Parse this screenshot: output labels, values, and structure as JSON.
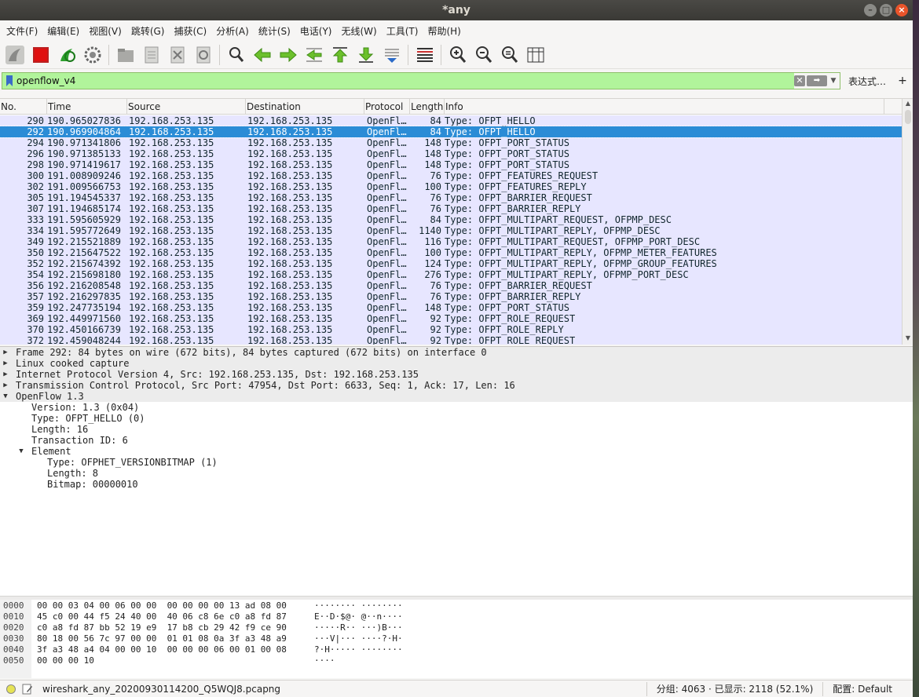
{
  "window": {
    "title": "*any"
  },
  "menu": [
    "文件(F)",
    "编辑(E)",
    "视图(V)",
    "跳转(G)",
    "捕获(C)",
    "分析(A)",
    "统计(S)",
    "电话(Y)",
    "无线(W)",
    "工具(T)",
    "帮助(H)"
  ],
  "filter": {
    "value": "openflow_v4",
    "expression_label": "表达式…",
    "plus_label": "+"
  },
  "packet_list": {
    "columns": [
      "No.",
      "Time",
      "Source",
      "Destination",
      "Protocol",
      "Length",
      "Info"
    ],
    "rows": [
      {
        "no": "290",
        "time": "190.965027836",
        "src": "192.168.253.135",
        "dst": "192.168.253.135",
        "proto": "OpenFl…",
        "len": "84",
        "info": "Type: OFPT_HELLO"
      },
      {
        "no": "292",
        "time": "190.969904864",
        "src": "192.168.253.135",
        "dst": "192.168.253.135",
        "proto": "OpenFl…",
        "len": "84",
        "info": "Type: OFPT_HELLO"
      },
      {
        "no": "294",
        "time": "190.971341806",
        "src": "192.168.253.135",
        "dst": "192.168.253.135",
        "proto": "OpenFl…",
        "len": "148",
        "info": "Type: OFPT_PORT_STATUS"
      },
      {
        "no": "296",
        "time": "190.971385133",
        "src": "192.168.253.135",
        "dst": "192.168.253.135",
        "proto": "OpenFl…",
        "len": "148",
        "info": "Type: OFPT_PORT_STATUS"
      },
      {
        "no": "298",
        "time": "190.971419617",
        "src": "192.168.253.135",
        "dst": "192.168.253.135",
        "proto": "OpenFl…",
        "len": "148",
        "info": "Type: OFPT_PORT_STATUS"
      },
      {
        "no": "300",
        "time": "191.008909246",
        "src": "192.168.253.135",
        "dst": "192.168.253.135",
        "proto": "OpenFl…",
        "len": "76",
        "info": "Type: OFPT_FEATURES_REQUEST"
      },
      {
        "no": "302",
        "time": "191.009566753",
        "src": "192.168.253.135",
        "dst": "192.168.253.135",
        "proto": "OpenFl…",
        "len": "100",
        "info": "Type: OFPT_FEATURES_REPLY"
      },
      {
        "no": "305",
        "time": "191.194545337",
        "src": "192.168.253.135",
        "dst": "192.168.253.135",
        "proto": "OpenFl…",
        "len": "76",
        "info": "Type: OFPT_BARRIER_REQUEST"
      },
      {
        "no": "307",
        "time": "191.194685174",
        "src": "192.168.253.135",
        "dst": "192.168.253.135",
        "proto": "OpenFl…",
        "len": "76",
        "info": "Type: OFPT_BARRIER_REPLY"
      },
      {
        "no": "333",
        "time": "191.595605929",
        "src": "192.168.253.135",
        "dst": "192.168.253.135",
        "proto": "OpenFl…",
        "len": "84",
        "info": "Type: OFPT_MULTIPART_REQUEST, OFPMP_DESC"
      },
      {
        "no": "334",
        "time": "191.595772649",
        "src": "192.168.253.135",
        "dst": "192.168.253.135",
        "proto": "OpenFl…",
        "len": "1140",
        "info": "Type: OFPT_MULTIPART_REPLY, OFPMP_DESC"
      },
      {
        "no": "349",
        "time": "192.215521889",
        "src": "192.168.253.135",
        "dst": "192.168.253.135",
        "proto": "OpenFl…",
        "len": "116",
        "info": "Type: OFPT_MULTIPART_REQUEST, OFPMP_PORT_DESC"
      },
      {
        "no": "350",
        "time": "192.215647522",
        "src": "192.168.253.135",
        "dst": "192.168.253.135",
        "proto": "OpenFl…",
        "len": "100",
        "info": "Type: OFPT_MULTIPART_REPLY, OFPMP_METER_FEATURES"
      },
      {
        "no": "352",
        "time": "192.215674392",
        "src": "192.168.253.135",
        "dst": "192.168.253.135",
        "proto": "OpenFl…",
        "len": "124",
        "info": "Type: OFPT_MULTIPART_REPLY, OFPMP_GROUP_FEATURES"
      },
      {
        "no": "354",
        "time": "192.215698180",
        "src": "192.168.253.135",
        "dst": "192.168.253.135",
        "proto": "OpenFl…",
        "len": "276",
        "info": "Type: OFPT_MULTIPART_REPLY, OFPMP_PORT_DESC"
      },
      {
        "no": "356",
        "time": "192.216208548",
        "src": "192.168.253.135",
        "dst": "192.168.253.135",
        "proto": "OpenFl…",
        "len": "76",
        "info": "Type: OFPT_BARRIER_REQUEST"
      },
      {
        "no": "357",
        "time": "192.216297835",
        "src": "192.168.253.135",
        "dst": "192.168.253.135",
        "proto": "OpenFl…",
        "len": "76",
        "info": "Type: OFPT_BARRIER_REPLY"
      },
      {
        "no": "359",
        "time": "192.247735194",
        "src": "192.168.253.135",
        "dst": "192.168.253.135",
        "proto": "OpenFl…",
        "len": "148",
        "info": "Type: OFPT_PORT_STATUS"
      },
      {
        "no": "369",
        "time": "192.449971560",
        "src": "192.168.253.135",
        "dst": "192.168.253.135",
        "proto": "OpenFl…",
        "len": "92",
        "info": "Type: OFPT_ROLE_REQUEST"
      },
      {
        "no": "370",
        "time": "192.450166739",
        "src": "192.168.253.135",
        "dst": "192.168.253.135",
        "proto": "OpenFl…",
        "len": "92",
        "info": "Type: OFPT_ROLE_REPLY"
      },
      {
        "no": "372",
        "time": "192.459048244",
        "src": "192.168.253.135",
        "dst": "192.168.253.135",
        "proto": "OpenFl…",
        "len": "92",
        "info": "Type: OFPT_ROLE_REQUEST"
      }
    ],
    "selected_no": "292"
  },
  "details": [
    {
      "text": "Frame 292: 84 bytes on wire (672 bits), 84 bytes captured (672 bits) on interface 0",
      "indent": 0,
      "toggle": "closed",
      "top": true
    },
    {
      "text": "Linux cooked capture",
      "indent": 0,
      "toggle": "closed",
      "top": true
    },
    {
      "text": "Internet Protocol Version 4, Src: 192.168.253.135, Dst: 192.168.253.135",
      "indent": 0,
      "toggle": "closed",
      "top": true
    },
    {
      "text": "Transmission Control Protocol, Src Port: 47954, Dst Port: 6633, Seq: 1, Ack: 17, Len: 16",
      "indent": 0,
      "toggle": "closed",
      "top": true
    },
    {
      "text": "OpenFlow 1.3",
      "indent": 0,
      "toggle": "open",
      "top": true
    },
    {
      "text": "Version: 1.3 (0x04)",
      "indent": 1,
      "toggle": "none",
      "top": false
    },
    {
      "text": "Type: OFPT_HELLO (0)",
      "indent": 1,
      "toggle": "none",
      "top": false
    },
    {
      "text": "Length: 16",
      "indent": 1,
      "toggle": "none",
      "top": false
    },
    {
      "text": "Transaction ID: 6",
      "indent": 1,
      "toggle": "none",
      "top": false
    },
    {
      "text": "Element",
      "indent": 1,
      "toggle": "open",
      "top": false
    },
    {
      "text": "Type: OFPHET_VERSIONBITMAP (1)",
      "indent": 2,
      "toggle": "none",
      "top": false
    },
    {
      "text": "Length: 8",
      "indent": 2,
      "toggle": "none",
      "top": false
    },
    {
      "text": "Bitmap: 00000010",
      "indent": 2,
      "toggle": "none",
      "top": false
    }
  ],
  "bytes": [
    {
      "off": "0000",
      "hex": "00 00 03 04 00 06 00 00  00 00 00 00 13 ad 08 00",
      "ascii": "········ ········"
    },
    {
      "off": "0010",
      "hex": "45 c0 00 44 f5 24 40 00  40 06 c8 6e c0 a8 fd 87",
      "ascii": "E··D·$@· @··n····"
    },
    {
      "off": "0020",
      "hex": "c0 a8 fd 87 bb 52 19 e9  17 b8 cb 29 42 f9 ce 90",
      "ascii": "·····R·· ···)B···"
    },
    {
      "off": "0030",
      "hex": "80 18 00 56 7c 97 00 00  01 01 08 0a 3f a3 48 a9",
      "ascii": "···V|··· ····?·H·"
    },
    {
      "off": "0040",
      "hex": "3f a3 48 a4 04 00 00 10  00 00 00 06 00 01 00 08",
      "ascii": "?·H····· ········"
    },
    {
      "off": "0050",
      "hex": "00 00 00 10",
      "ascii": "····"
    }
  ],
  "status": {
    "file": "wireshark_any_20200930114200_Q5WQJ8.pcapng",
    "stats": "分组: 4063 · 已显示: 2118 (52.1%)",
    "profile": "配置: Default"
  },
  "colors": {
    "row_bg": "#e7e6ff",
    "selected_bg": "#2b8cd6",
    "filter_ok_bg": "#b1f49b",
    "close_btn": "#e9542a"
  }
}
